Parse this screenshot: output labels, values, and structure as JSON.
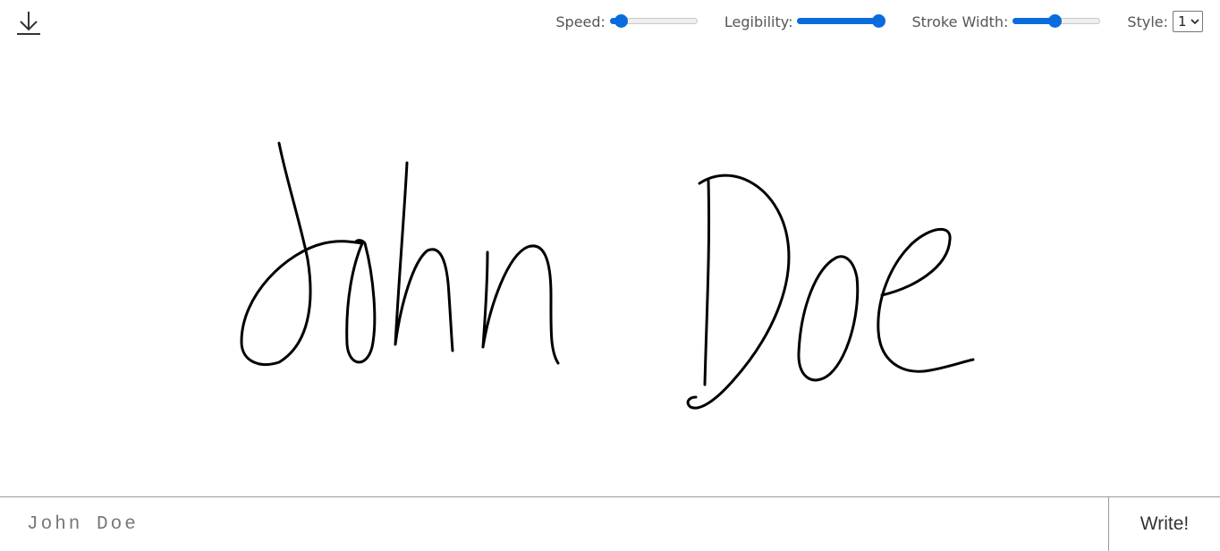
{
  "toolbar": {
    "download_icon": "download-icon",
    "speed": {
      "label": "Speed:",
      "value": 0.12
    },
    "legibility": {
      "label": "Legibility:",
      "value": 0.92
    },
    "stroke_width": {
      "label": "Stroke Width:",
      "value": 0.48
    },
    "style": {
      "label": "Style:",
      "value": "1",
      "caret_icon": "chevron-down-icon"
    }
  },
  "canvas": {
    "content": "handwritten-signature",
    "stroke_color": "#000000"
  },
  "input": {
    "value": "John Doe"
  },
  "write_button": {
    "label": "Write!"
  },
  "colors": {
    "accent": "#0a6cdc",
    "text": "#555555",
    "border": "#9a9a9a"
  }
}
